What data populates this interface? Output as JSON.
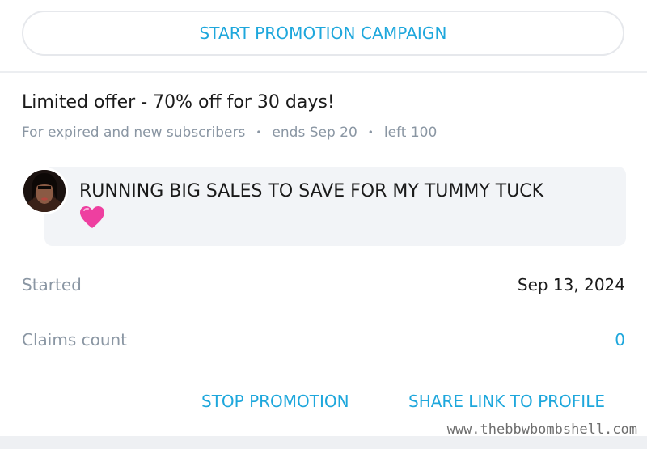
{
  "campaign": {
    "start_label": "START PROMOTION CAMPAIGN"
  },
  "offer": {
    "title": "Limited offer - 70% off for 30 days!",
    "audience": "For expired and new subscribers",
    "ends": "ends Sep 20",
    "left": "left 100",
    "separator": "•"
  },
  "message": {
    "text": "RUNNING BIG SALES TO SAVE FOR MY TUMMY TUCK",
    "emoji": "pink-heart-icon"
  },
  "details": {
    "started_label": "Started",
    "started_value": "Sep 13, 2024",
    "claims_label": "Claims count",
    "claims_value": "0"
  },
  "actions": {
    "stop_label": "STOP PROMOTION",
    "share_label": "SHARE LINK TO PROFILE"
  },
  "watermark": "www.thebbwbombshell.com",
  "colors": {
    "accent": "#1ea7dc",
    "muted": "#8a96a3",
    "text": "#1a1a1a",
    "bubble": "#f2f4f7",
    "heart": "#ee3fa0"
  }
}
